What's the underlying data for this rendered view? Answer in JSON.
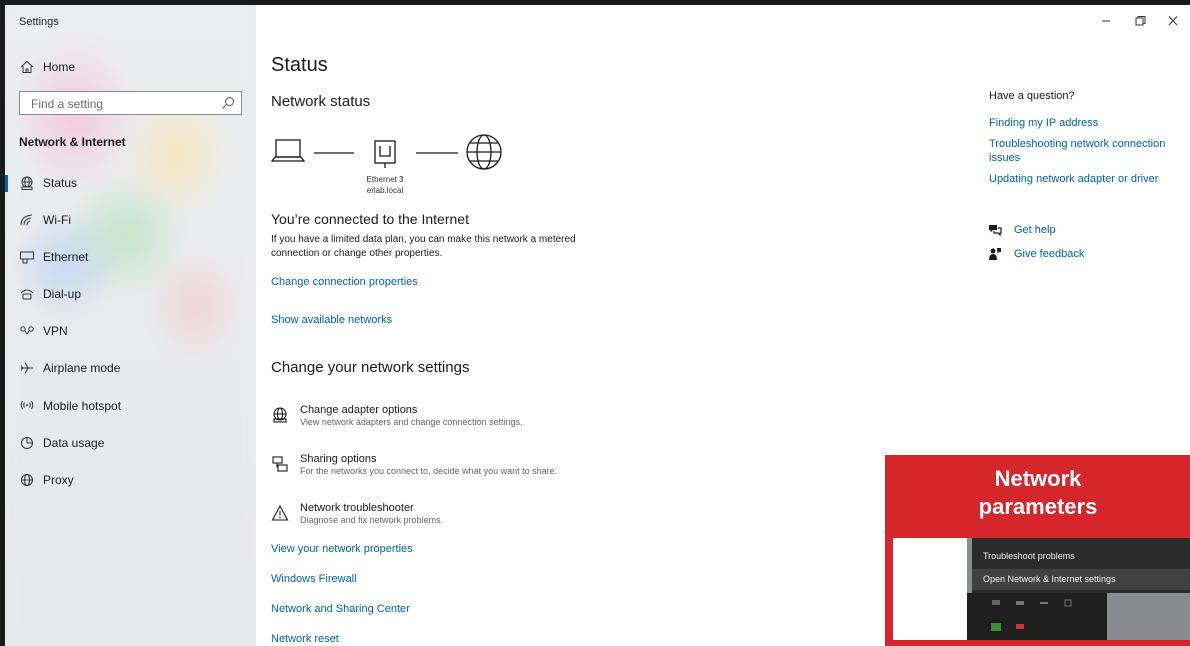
{
  "window": {
    "title": "Settings"
  },
  "sidebar": {
    "home_label": "Home",
    "search_placeholder": "Find a setting",
    "section_title": "Network & Internet",
    "items": [
      {
        "label": "Status",
        "icon": "globe-network-icon",
        "active": true
      },
      {
        "label": "Wi-Fi",
        "icon": "wifi-icon"
      },
      {
        "label": "Ethernet",
        "icon": "ethernet-icon"
      },
      {
        "label": "Dial-up",
        "icon": "dialup-icon"
      },
      {
        "label": "VPN",
        "icon": "vpn-icon"
      },
      {
        "label": "Airplane mode",
        "icon": "airplane-icon"
      },
      {
        "label": "Mobile hotspot",
        "icon": "hotspot-icon"
      },
      {
        "label": "Data usage",
        "icon": "data-usage-icon"
      },
      {
        "label": "Proxy",
        "icon": "proxy-globe-icon"
      }
    ]
  },
  "main": {
    "page_title": "Status",
    "network_status_heading": "Network status",
    "diagram": {
      "adapter_name": "Ethernet 3",
      "domain": "erlab.local"
    },
    "connected_title": "You’re connected to the Internet",
    "connected_desc": "If you have a limited data plan, you can make this network a metered connection or change other properties.",
    "links_top": [
      "Change connection properties",
      "Show available networks"
    ],
    "change_heading": "Change your network settings",
    "options": [
      {
        "title": "Change adapter options",
        "subtitle": "View network adapters and change connection settings.",
        "icon": "adapter-icon"
      },
      {
        "title": "Sharing options",
        "subtitle": "For the networks you connect to, decide what you want to share.",
        "icon": "sharing-icon"
      },
      {
        "title": "Network troubleshooter",
        "subtitle": "Diagnose and fix network problems.",
        "icon": "warning-icon"
      }
    ],
    "links_bottom": [
      "View your network properties",
      "Windows Firewall",
      "Network and Sharing Center",
      "Network reset"
    ]
  },
  "right": {
    "question_heading": "Have a question?",
    "links": [
      "Finding my IP address",
      "Troubleshooting network connection issues",
      "Updating network adapter or driver"
    ],
    "get_help": "Get help",
    "give_feedback": "Give feedback"
  },
  "overlay": {
    "title_line1": "Network",
    "title_line2": "parameters",
    "menu_items": [
      "Troubleshoot problems",
      "Open Network & Internet settings"
    ]
  },
  "colors": {
    "accent": "#0063b1",
    "overlay_red": "#d5262c"
  }
}
